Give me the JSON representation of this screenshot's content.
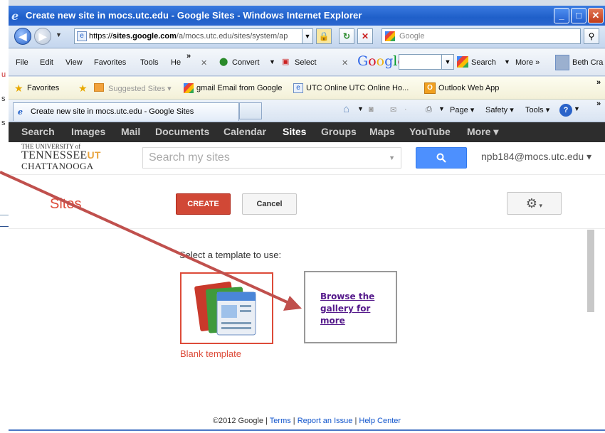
{
  "window": {
    "title": "Create new site in mocs.utc.edu - Google Sites - Windows Internet Explorer"
  },
  "nav": {
    "url_prefix": "https://",
    "url_host": "sites.google.com",
    "url_rest": "/a/mocs.utc.edu/sites/system/ap",
    "search_placeholder": "Google"
  },
  "toolbar": {
    "file": "File",
    "edit": "Edit",
    "view": "View",
    "favorites": "Favorites",
    "tools": "Tools",
    "help": "He",
    "more_chevron": "»",
    "convert": "Convert",
    "select": "Select",
    "google_logo": "Google",
    "search": "Search",
    "more": "More »",
    "user": "Beth Cra"
  },
  "favbar": {
    "favorites": "Favorites",
    "suggested": "Suggested Sites ▾",
    "gmail": "gmail Email from Google",
    "utc": "UTC Online  UTC Online Ho...",
    "owa": "Outlook Web App",
    "more": "»"
  },
  "tabbar": {
    "tab_title": "Create new site in mocs.utc.edu - Google Sites",
    "page": "Page ▾",
    "safety": "Safety ▾",
    "tools": "Tools ▾",
    "more": "»"
  },
  "googlebar": {
    "items": [
      "Search",
      "Images",
      "Mail",
      "Documents",
      "Calendar",
      "Sites",
      "Groups",
      "Maps",
      "YouTube",
      "More ▾"
    ]
  },
  "header": {
    "logo_line1": "THE UNIVERSITY of",
    "logo_line2": "TENNESSEE",
    "logo_ut": "UT",
    "logo_line3": "CHATTANOOGA",
    "search_placeholder": "Search my sites",
    "user_email": "npb184@mocs.utc.edu ▾"
  },
  "sites_header": {
    "title": "Sites",
    "create_label": "CREATE",
    "cancel_label": "Cancel"
  },
  "templates": {
    "prompt": "Select a template to use:",
    "blank_caption": "Blank template",
    "browse_label": "Browse the gallery for more"
  },
  "footer": {
    "copyright": "©2012 Google | ",
    "terms": "Terms",
    "report": "Report an Issue",
    "help": "Help Center",
    "sep": " | "
  },
  "left_stub": {
    "text1": "u",
    "text2": "s",
    "text3": "s"
  },
  "colors": {
    "accent_red": "#dd4b39",
    "google_blue": "#4d90fe",
    "ie_titlebar": "#1f5fc9",
    "annotation_arrow": "#c0504d"
  }
}
